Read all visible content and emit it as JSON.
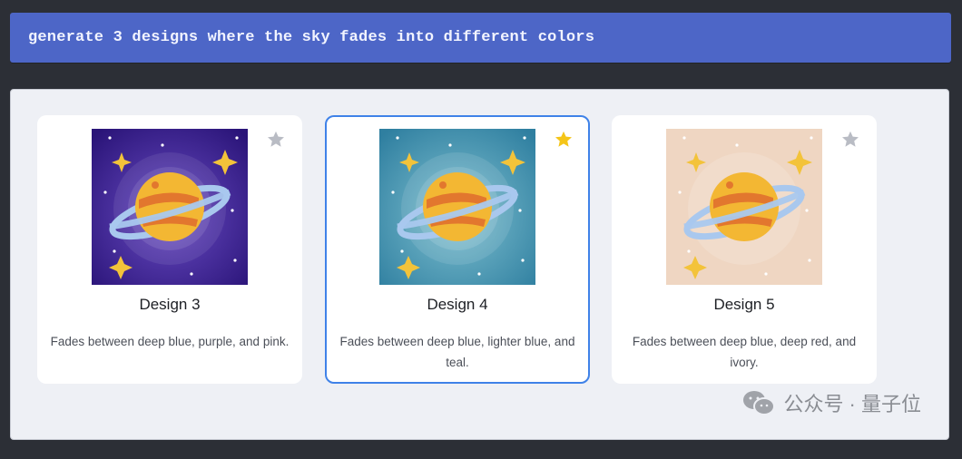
{
  "prompt": {
    "text": "generate 3 designs where the sky fades into different colors"
  },
  "designs": [
    {
      "title": "Design 3",
      "description": "Fades between deep blue, purple, and pink.",
      "favorited": false,
      "sky_color": "#3b1f8c",
      "star_color": "#b9bcc4"
    },
    {
      "title": "Design 4",
      "description": "Fades between deep blue, lighter blue, and teal.",
      "favorited": true,
      "selected": true,
      "sky_color": "#3d91ad",
      "star_color": "#f5c518"
    },
    {
      "title": "Design 5",
      "description": "Fades between deep blue, deep red, and ivory.",
      "favorited": false,
      "sky_color": "#efd6c2",
      "star_color": "#b9bcc4"
    }
  ],
  "watermark": {
    "text": "公众号 · 量子位",
    "icon": "wechat-icon"
  },
  "colors": {
    "accent": "#4d66c7",
    "selected_border": "#3f82e8"
  }
}
